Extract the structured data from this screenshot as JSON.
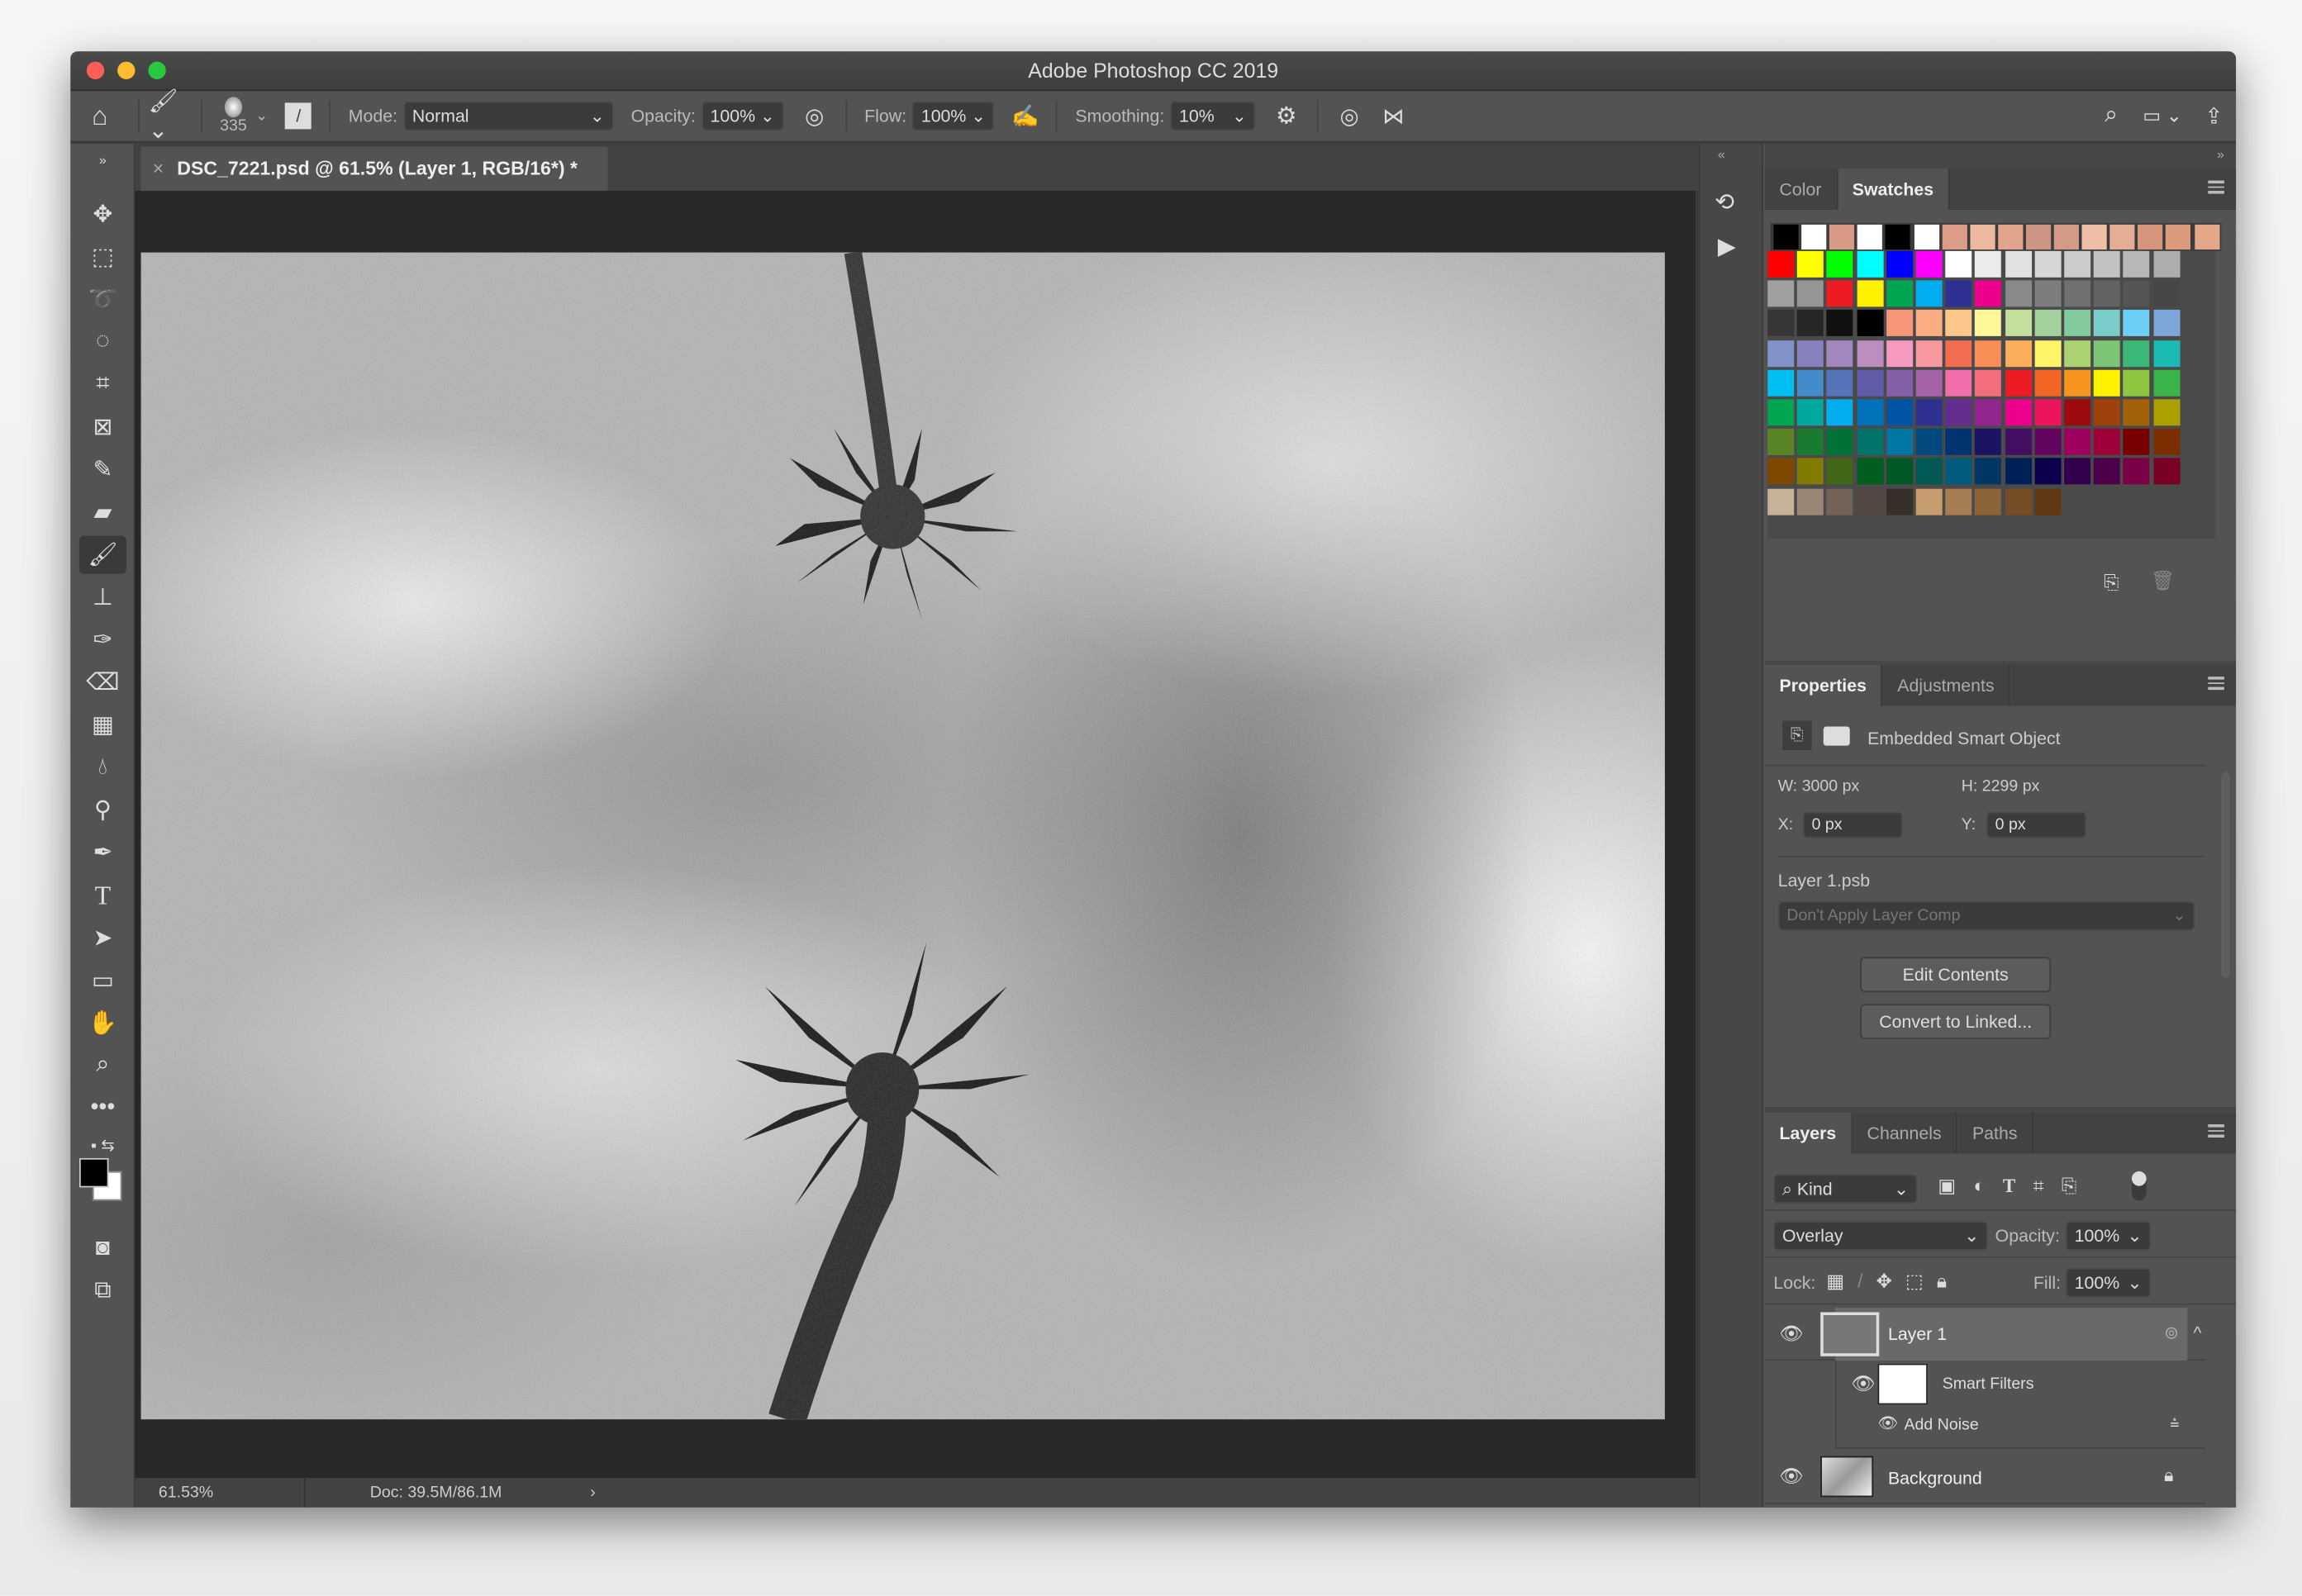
{
  "window": {
    "title": "Adobe Photoshop CC 2019"
  },
  "options": {
    "brush_size": "335",
    "mode_label": "Mode:",
    "mode_value": "Normal",
    "opacity_label": "Opacity:",
    "opacity_value": "100%",
    "flow_label": "Flow:",
    "flow_value": "100%",
    "smoothing_label": "Smoothing:",
    "smoothing_value": "10%"
  },
  "document": {
    "tab_title": "DSC_7221.psd @ 61.5% (Layer 1, RGB/16*) *",
    "zoom": "61.53%",
    "doc_size": "Doc: 39.5M/86.1M"
  },
  "swatches_panel": {
    "tabs": [
      "Color",
      "Swatches"
    ],
    "active": "Swatches",
    "recent": [
      "#000000",
      "#ffffff",
      "#d99a85",
      "#ffffff",
      "#000000",
      "#ffffff",
      "#dc9c86",
      "#ecb8a0",
      "#e2a58b",
      "#cf9584",
      "#d49a88",
      "#eebfa6",
      "#e4ad95",
      "#d5957a",
      "#dc9a7d",
      "#e4a789"
    ],
    "grid": [
      [
        "#ff0000",
        "#ffff00",
        "#00ff00",
        "#00ffff",
        "#0000ff",
        "#ff00ff",
        "#ffffff",
        "#ebebeb",
        "#e1e1e1",
        "#d6d6d6",
        "#cccccc",
        "#c2c2c2",
        "#b7b7b7",
        "#adadad"
      ],
      [
        "#a0a0a0",
        "#959595",
        "#ed1c24",
        "#fff200",
        "#00a651",
        "#00aeef",
        "#2e3192",
        "#ec008c",
        "#898989",
        "#7d7d7d",
        "#707070",
        "#636363",
        "#555555",
        "#464646"
      ],
      [
        "#363636",
        "#262626",
        "#111111",
        "#000000",
        "#f7977a",
        "#f9ad81",
        "#fdc68a",
        "#fff79a",
        "#c4df9b",
        "#a3d39c",
        "#82ca9d",
        "#7accc8",
        "#6dcff6",
        "#7da7d9"
      ],
      [
        "#8393ca",
        "#8781bd",
        "#a187be",
        "#bc8dbf",
        "#f49ac2",
        "#f6989d",
        "#f26c4f",
        "#f68e55",
        "#fbaf5c",
        "#fff467",
        "#acd372",
        "#7cc576",
        "#3bb878",
        "#1abbb4"
      ],
      [
        "#00bff3",
        "#438ccb",
        "#5574b9",
        "#605ca8",
        "#855fa8",
        "#a763a8",
        "#f06eaa",
        "#f26d7d",
        "#ed1c24",
        "#f26522",
        "#f7941d",
        "#fff200",
        "#8dc73f",
        "#39b54a"
      ],
      [
        "#00a651",
        "#00a99d",
        "#00aeef",
        "#0072bc",
        "#0054a6",
        "#2e3192",
        "#662d91",
        "#92278f",
        "#ec008c",
        "#ed145b",
        "#9e0b0f",
        "#a0410d",
        "#a36209",
        "#aba000"
      ],
      [
        "#598527",
        "#197b30",
        "#007236",
        "#00746b",
        "#0076a3",
        "#004a80",
        "#003471",
        "#1b1464",
        "#440e62",
        "#630460",
        "#9e005d",
        "#9e0039",
        "#790000",
        "#7b2e00"
      ],
      [
        "#7d4900",
        "#827b00",
        "#406618",
        "#005e20",
        "#005826",
        "#005952",
        "#005b7f",
        "#003663",
        "#002157",
        "#0d004c",
        "#32004b",
        "#4b0049",
        "#7b0046",
        "#7a0026"
      ],
      [
        "#c7b299",
        "#998675",
        "#736357",
        "#534741",
        "#37302a",
        "#c69c6d",
        "#a67c52",
        "#8c6239",
        "#754c24",
        "#603913"
      ]
    ]
  },
  "properties_panel": {
    "tabs": [
      "Properties",
      "Adjustments"
    ],
    "type": "Embedded Smart Object",
    "w_label": "W:",
    "w": "3000 px",
    "h_label": "H:",
    "h": "2299 px",
    "x_label": "X:",
    "x": "0 px",
    "y_label": "Y:",
    "y": "0 px",
    "file": "Layer 1.psb",
    "layer_comp": "Don't Apply Layer Comp",
    "edit_contents": "Edit Contents",
    "convert": "Convert to Linked..."
  },
  "layers_panel": {
    "tabs": [
      "Layers",
      "Channels",
      "Paths"
    ],
    "filter": "Kind",
    "blend": "Overlay",
    "opacity_label": "Opacity:",
    "opacity": "100%",
    "lock_label": "Lock:",
    "fill_label": "Fill:",
    "fill": "100%",
    "layers": [
      {
        "name": "Layer 1"
      },
      {
        "name": "Smart Filters"
      },
      {
        "name": "Add Noise"
      },
      {
        "name": "Background"
      }
    ]
  }
}
